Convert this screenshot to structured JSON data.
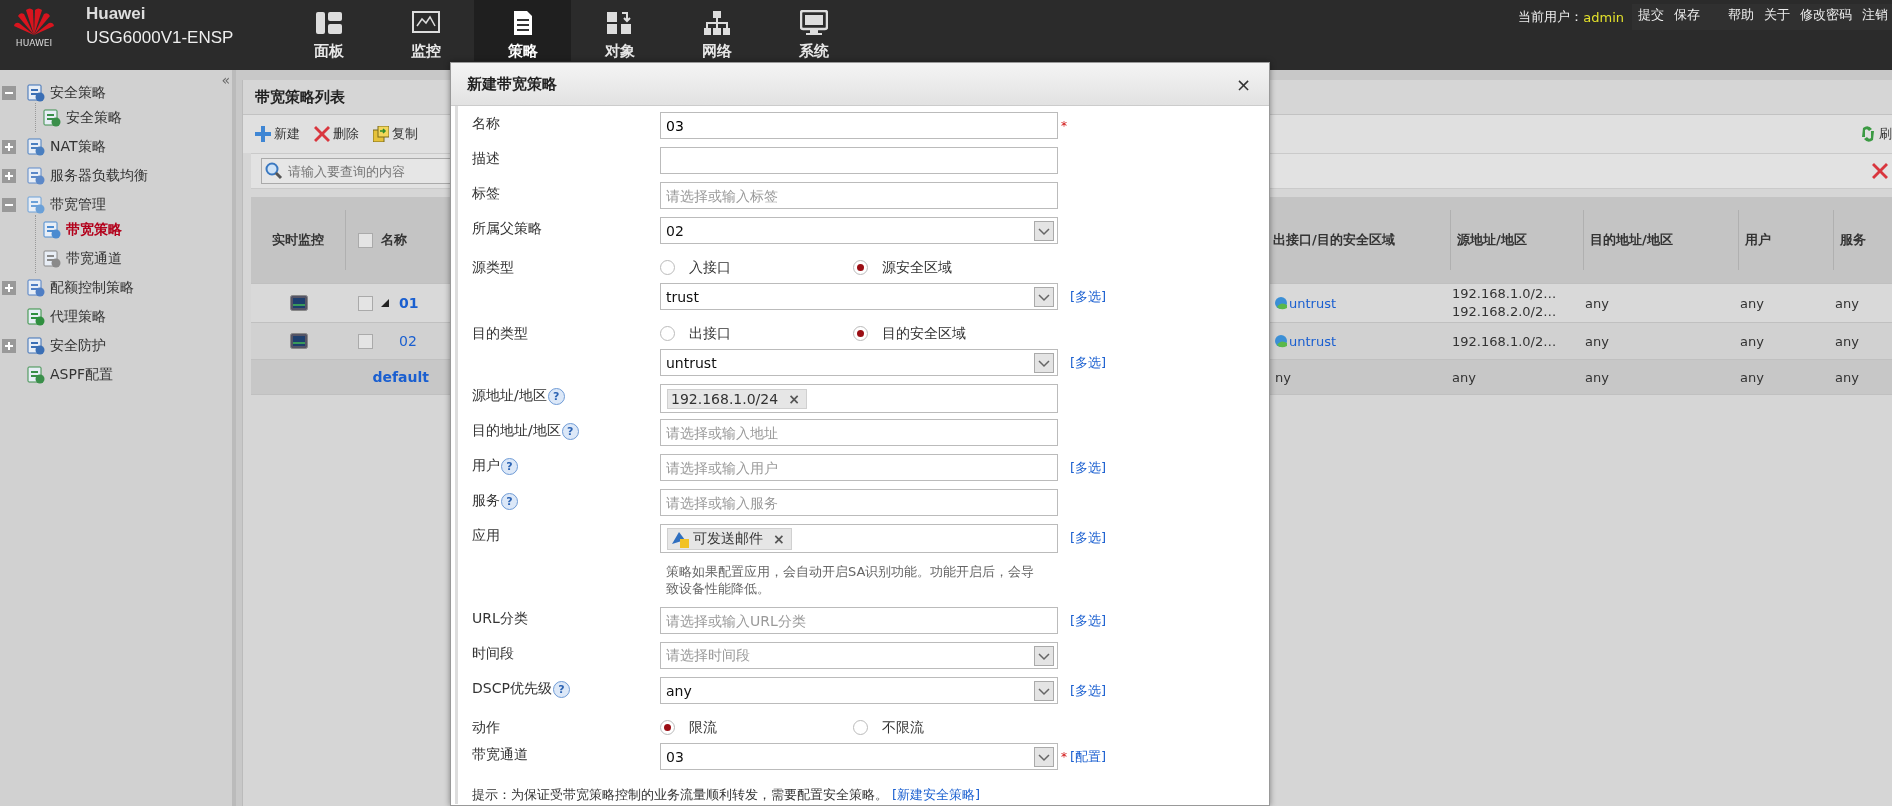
{
  "header": {
    "logo_text": "HUAWEI",
    "brand": "Huawei",
    "model": "USG6000V1-ENSP",
    "nav": [
      {
        "label": "面板",
        "selected": false
      },
      {
        "label": "监控",
        "selected": false
      },
      {
        "label": "策略",
        "selected": true
      },
      {
        "label": "对象",
        "selected": false
      },
      {
        "label": "网络",
        "selected": false
      },
      {
        "label": "系统",
        "selected": false
      }
    ],
    "user_label": "当前用户：",
    "user": "admin",
    "links": [
      "提交",
      "保存",
      "帮助",
      "关于",
      "修改密码",
      "注销"
    ]
  },
  "sidebar": {
    "collapse": "«",
    "items": [
      {
        "label": "安全策略",
        "expanded": true,
        "selected": false,
        "children": [
          {
            "label": "安全策略",
            "selected": false
          }
        ]
      },
      {
        "label": "NAT策略",
        "expanded": false,
        "selected": false
      },
      {
        "label": "服务器负载均衡",
        "expanded": false,
        "selected": false
      },
      {
        "label": "带宽管理",
        "expanded": true,
        "selected": false,
        "children": [
          {
            "label": "带宽策略",
            "selected": true
          },
          {
            "label": "带宽通道",
            "selected": false
          }
        ]
      },
      {
        "label": "配额控制策略",
        "expanded": false,
        "selected": false
      },
      {
        "label": "代理策略",
        "selected": false
      },
      {
        "label": "安全防护",
        "expanded": false,
        "selected": false
      },
      {
        "label": "ASPF配置",
        "selected": false
      }
    ]
  },
  "panel": {
    "title": "带宽策略列表",
    "toolbar": [
      "新建",
      "删除",
      "复制"
    ],
    "refresh": "刷",
    "search": {
      "placeholder": "请输入要查询的内容"
    },
    "table": {
      "left_columns": [
        {
          "label": "实时监控"
        },
        {
          "label": "名称",
          "checked": false
        }
      ],
      "right_columns": [
        "出接口/目的安全区域",
        "源地址/地区",
        "目的地址/地区",
        "用户",
        "服务"
      ],
      "rows": [
        {
          "monitor": true,
          "checked": false,
          "expanded": true,
          "parent": true,
          "name": "01",
          "cells": [
            {
              "kind": "zone",
              "text": "untrust"
            },
            {
              "kind": "lines",
              "lines": [
                "192.168.1.0/2…",
                "192.168.2.0/2…"
              ]
            },
            {
              "kind": "plain",
              "text": "any"
            },
            {
              "kind": "plain",
              "text": "any"
            },
            {
              "kind": "plain",
              "text": "any"
            }
          ]
        },
        {
          "monitor": true,
          "checked": false,
          "parent": false,
          "name": "02",
          "cells": [
            {
              "kind": "zone",
              "text": "untrust"
            },
            {
              "kind": "plain",
              "text": "192.168.1.0/2…"
            },
            {
              "kind": "plain",
              "text": "any"
            },
            {
              "kind": "plain",
              "text": "any"
            },
            {
              "kind": "plain",
              "text": "any"
            }
          ]
        },
        {
          "parent": true,
          "name": "default",
          "cells": [
            {
              "kind": "plain",
              "text": "ny"
            },
            {
              "kind": "plain",
              "text": "any"
            },
            {
              "kind": "plain",
              "text": "any"
            },
            {
              "kind": "plain",
              "text": "any"
            },
            {
              "kind": "plain",
              "text": "any"
            }
          ]
        }
      ]
    }
  },
  "dialog": {
    "title": "新建带宽策略",
    "close": "×",
    "rows": [
      {
        "kind": "text",
        "label": "名称",
        "value": "03",
        "required": "*"
      },
      {
        "kind": "text",
        "label": "描述"
      },
      {
        "kind": "text",
        "label": "标签",
        "placeholder": "请选择或输入标签"
      },
      {
        "kind": "select",
        "label": "所属父策略",
        "value": "02"
      },
      {
        "kind": "radio",
        "label": "源类型",
        "options": [
          {
            "label": "入接口",
            "selected": false
          },
          {
            "label": "源安全区域",
            "selected": true
          }
        ]
      },
      {
        "kind": "select",
        "value": "trust",
        "link": "[多选]"
      },
      {
        "kind": "radio",
        "label": "目的类型",
        "options": [
          {
            "label": "出接口",
            "selected": false
          },
          {
            "label": "目的安全区域",
            "selected": true
          }
        ]
      },
      {
        "kind": "select",
        "value": "untrust",
        "link": "[多选]"
      },
      {
        "kind": "tags",
        "label": "源地址/地区",
        "help": "?",
        "tags": [
          {
            "text": "192.168.1.0/24",
            "remove": "×"
          }
        ]
      },
      {
        "kind": "text",
        "label": "目的地址/地区",
        "help": "?",
        "placeholder": "请选择或输入地址"
      },
      {
        "kind": "text",
        "label": "用户",
        "help": "?",
        "placeholder": "请选择或输入用户",
        "link": "[多选]"
      },
      {
        "kind": "text",
        "label": "服务",
        "help": "?",
        "placeholder": "请选择或输入服务"
      },
      {
        "kind": "tags",
        "label": "应用",
        "tags": [
          {
            "text": "可发送邮件",
            "remove": "×",
            "icon": true
          }
        ],
        "link": "[多选]"
      },
      {
        "kind": "note",
        "text": "策略如果配置应用，会自动开启SA识别功能。功能开启后，会导致设备性能降低。"
      },
      {
        "kind": "text",
        "label": "URL分类",
        "placeholder": "请选择或输入URL分类",
        "link": "[多选]"
      },
      {
        "kind": "select",
        "label": "时间段",
        "placeholder": "请选择时间段"
      },
      {
        "kind": "select",
        "label": "DSCP优先级",
        "help": "?",
        "value": "any",
        "link": "[多选]"
      },
      {
        "kind": "radio",
        "label": "动作",
        "options": [
          {
            "label": "限流",
            "selected": true
          },
          {
            "label": "不限流",
            "selected": false
          }
        ]
      },
      {
        "kind": "select",
        "label": "带宽通道",
        "value": "03",
        "link": "[配置]",
        "required": "*"
      }
    ],
    "tip": "提示：为保证受带宽策略控制的业务流量顺利转发，需要配置安全策略。",
    "tip_link": "[新建安全策略]"
  }
}
